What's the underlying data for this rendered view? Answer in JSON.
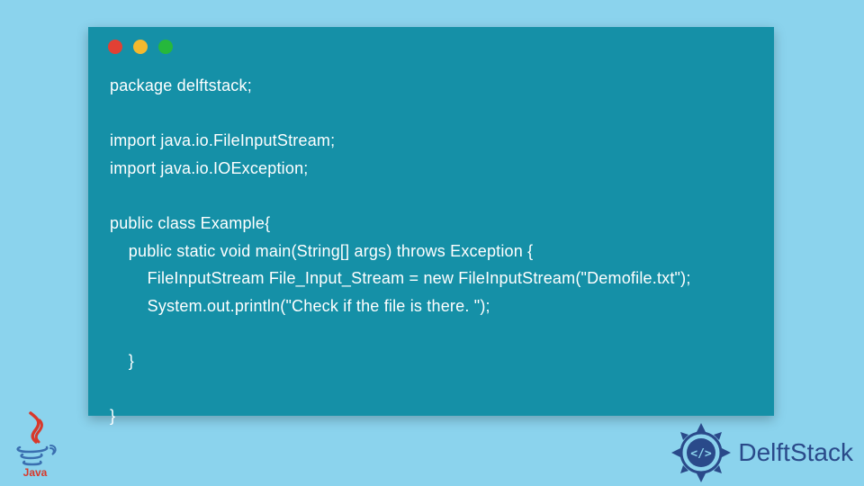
{
  "window": {
    "dots": [
      "red",
      "yellow",
      "green"
    ]
  },
  "code": {
    "lines": [
      "package delftstack;",
      "",
      "import java.io.FileInputStream;",
      "import java.io.IOException;",
      "",
      "public class Example{",
      "    public static void main(String[] args) throws Exception {",
      "        FileInputStream File_Input_Stream = new FileInputStream(\"Demofile.txt\");",
      "        System.out.println(\"Check if the file is there. \");",
      "",
      "    }",
      "",
      "}"
    ]
  },
  "logos": {
    "java_label": "Java",
    "delft_label": "DelftStack"
  },
  "colors": {
    "page_bg": "#8bd3ed",
    "window_bg": "#1590a7",
    "code_fg": "#ffffff",
    "dot_red": "#e24034",
    "dot_yellow": "#f4b92e",
    "dot_green": "#26b83c",
    "delft_blue": "#2a4a8a"
  }
}
